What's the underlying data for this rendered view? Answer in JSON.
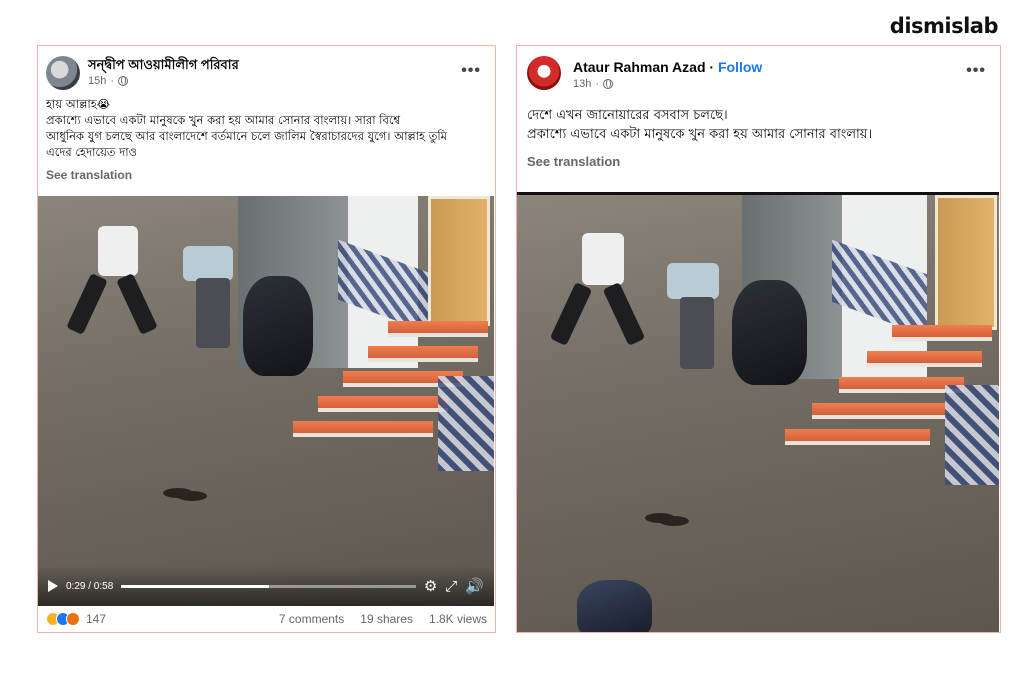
{
  "brand": {
    "name": "dismislab"
  },
  "left_post": {
    "author": "সন্দ্বীপ আওয়ামীলীগ পরিবার",
    "time": "15h",
    "text_lines": [
      "হায় আল্লাহ😭",
      "প্রকাশ্যে এভাবে একটা মানুষকে খুন করা হয় আমার সোনার বাংলায়। সারা বিশ্বে",
      "আধুনিক যুগ চলছে আর বাংলাদেশে বর্তমানে চলে জালিম স্বৈরাচারদের যুগে। আল্লাহ তুমি",
      "এদের হেদায়েত দাও"
    ],
    "see_translation": "See translation",
    "video": {
      "time_display": "0:29 / 0:58",
      "progress": 0.5
    },
    "reaction_count": "147",
    "comments": "7 comments",
    "shares": "19 shares",
    "views": "1.8K views"
  },
  "right_post": {
    "author": "Ataur Rahman Azad",
    "separator": "·",
    "follow": "Follow",
    "time": "13h",
    "text_lines": [
      "দেশে এখন জানোয়ারের বসবাস চলছে।",
      "প্রকাশ্যে এভাবে একটা মানুষকে খুন করা হয় আমার সোনার বাংলায়।"
    ],
    "see_translation": "See translation"
  },
  "icons": {
    "more": "more-options-icon",
    "globe": "globe-icon",
    "play": "play-icon",
    "settings": "gear-icon",
    "fullscreen": "fullscreen-icon",
    "volume": "volume-icon"
  }
}
